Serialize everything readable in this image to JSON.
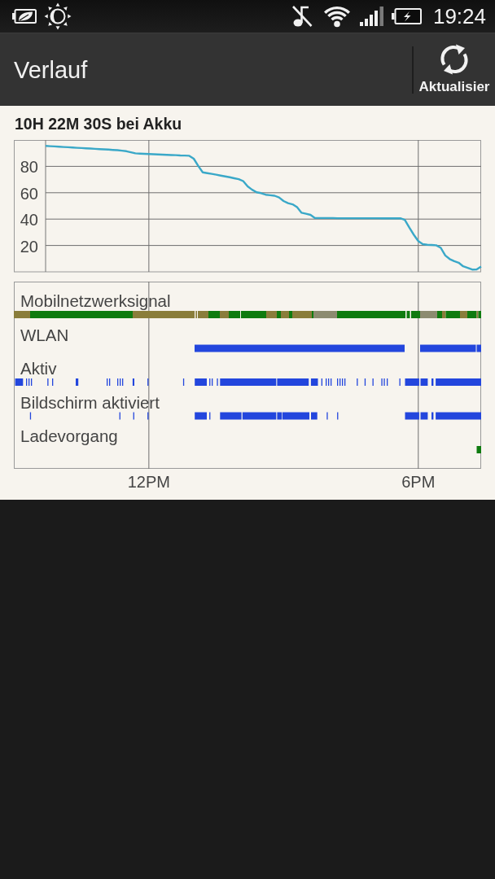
{
  "status_bar": {
    "time": "19:24"
  },
  "action_bar": {
    "title": "Verlauf",
    "refresh_button": {
      "label": "Aktualisier"
    }
  },
  "battery_history": {
    "summary": "10H 22M 30S bei Akku",
    "chart_data": {
      "type": "line",
      "grid": true,
      "categories": [
        null,
        null,
        null,
        null,
        null,
        null,
        null,
        null,
        null,
        null,
        null,
        null,
        null,
        null,
        null,
        null,
        null,
        null,
        null,
        null,
        null,
        null,
        null,
        null,
        null,
        null,
        null,
        null,
        null,
        null,
        null,
        null,
        null,
        null,
        null,
        null,
        null,
        null,
        null,
        null,
        null,
        null,
        null,
        null,
        null,
        null,
        null,
        null,
        null,
        null,
        null,
        null,
        null,
        null,
        null,
        null,
        null,
        null,
        null,
        null,
        null,
        null,
        null,
        null,
        null,
        null,
        null,
        null,
        null,
        null,
        null,
        null,
        null,
        null,
        null,
        null,
        null,
        null,
        null,
        null,
        null,
        null,
        null,
        null,
        null,
        null,
        null,
        null,
        null,
        null,
        null,
        null,
        null,
        null,
        null,
        null,
        null,
        null
      ],
      "series": [
        {
          "color": "#3aa8c8",
          "values": [
            95.5,
            95.3,
            95.1,
            94.9,
            94.7,
            94.5,
            94.3,
            94.1,
            93.9,
            93.7,
            93.5,
            93.3,
            93.1,
            92.9,
            92.7,
            92.5,
            92.3,
            91.9,
            91.5,
            90.7,
            89.9,
            89.7,
            89.5,
            89.3,
            89.2,
            89.0,
            88.9,
            88.7,
            88.6,
            88.5,
            88.3,
            88.2,
            88.0,
            85.8,
            80.3,
            75.5,
            74.9,
            74.3,
            73.7,
            73.0,
            72.4,
            71.7,
            71.0,
            70.3,
            68.8,
            64.8,
            62.3,
            60.3,
            59.7,
            58.5,
            58.1,
            57.7,
            56.4,
            53.7,
            52.1,
            51.2,
            49.0,
            44.8,
            44.0,
            43.2,
            40.8,
            40.8,
            40.8,
            40.8,
            40.8,
            40.7,
            40.7,
            40.7,
            40.7,
            40.7,
            40.7,
            40.7,
            40.7,
            40.7,
            40.7,
            40.6,
            40.6,
            40.6,
            40.6,
            40.6,
            39.4,
            33.5,
            28.1,
            23.3,
            21.0,
            20.5,
            20.4,
            20.1,
            18.2,
            12.4,
            9.7,
            8.1,
            6.9,
            4.2,
            3.0,
            1.7,
            1.8,
            4.0
          ]
        }
      ],
      "ylim": [
        0,
        100
      ],
      "yticks": [
        20,
        40,
        60,
        80
      ]
    },
    "timeline": {
      "rows": [
        "Mobilnetzwerksignal",
        "WLAN",
        "Aktiv",
        "Bildschirm aktiviert",
        "Ladevorgang"
      ],
      "axis_labels": [
        "12PM",
        "6PM"
      ]
    }
  }
}
